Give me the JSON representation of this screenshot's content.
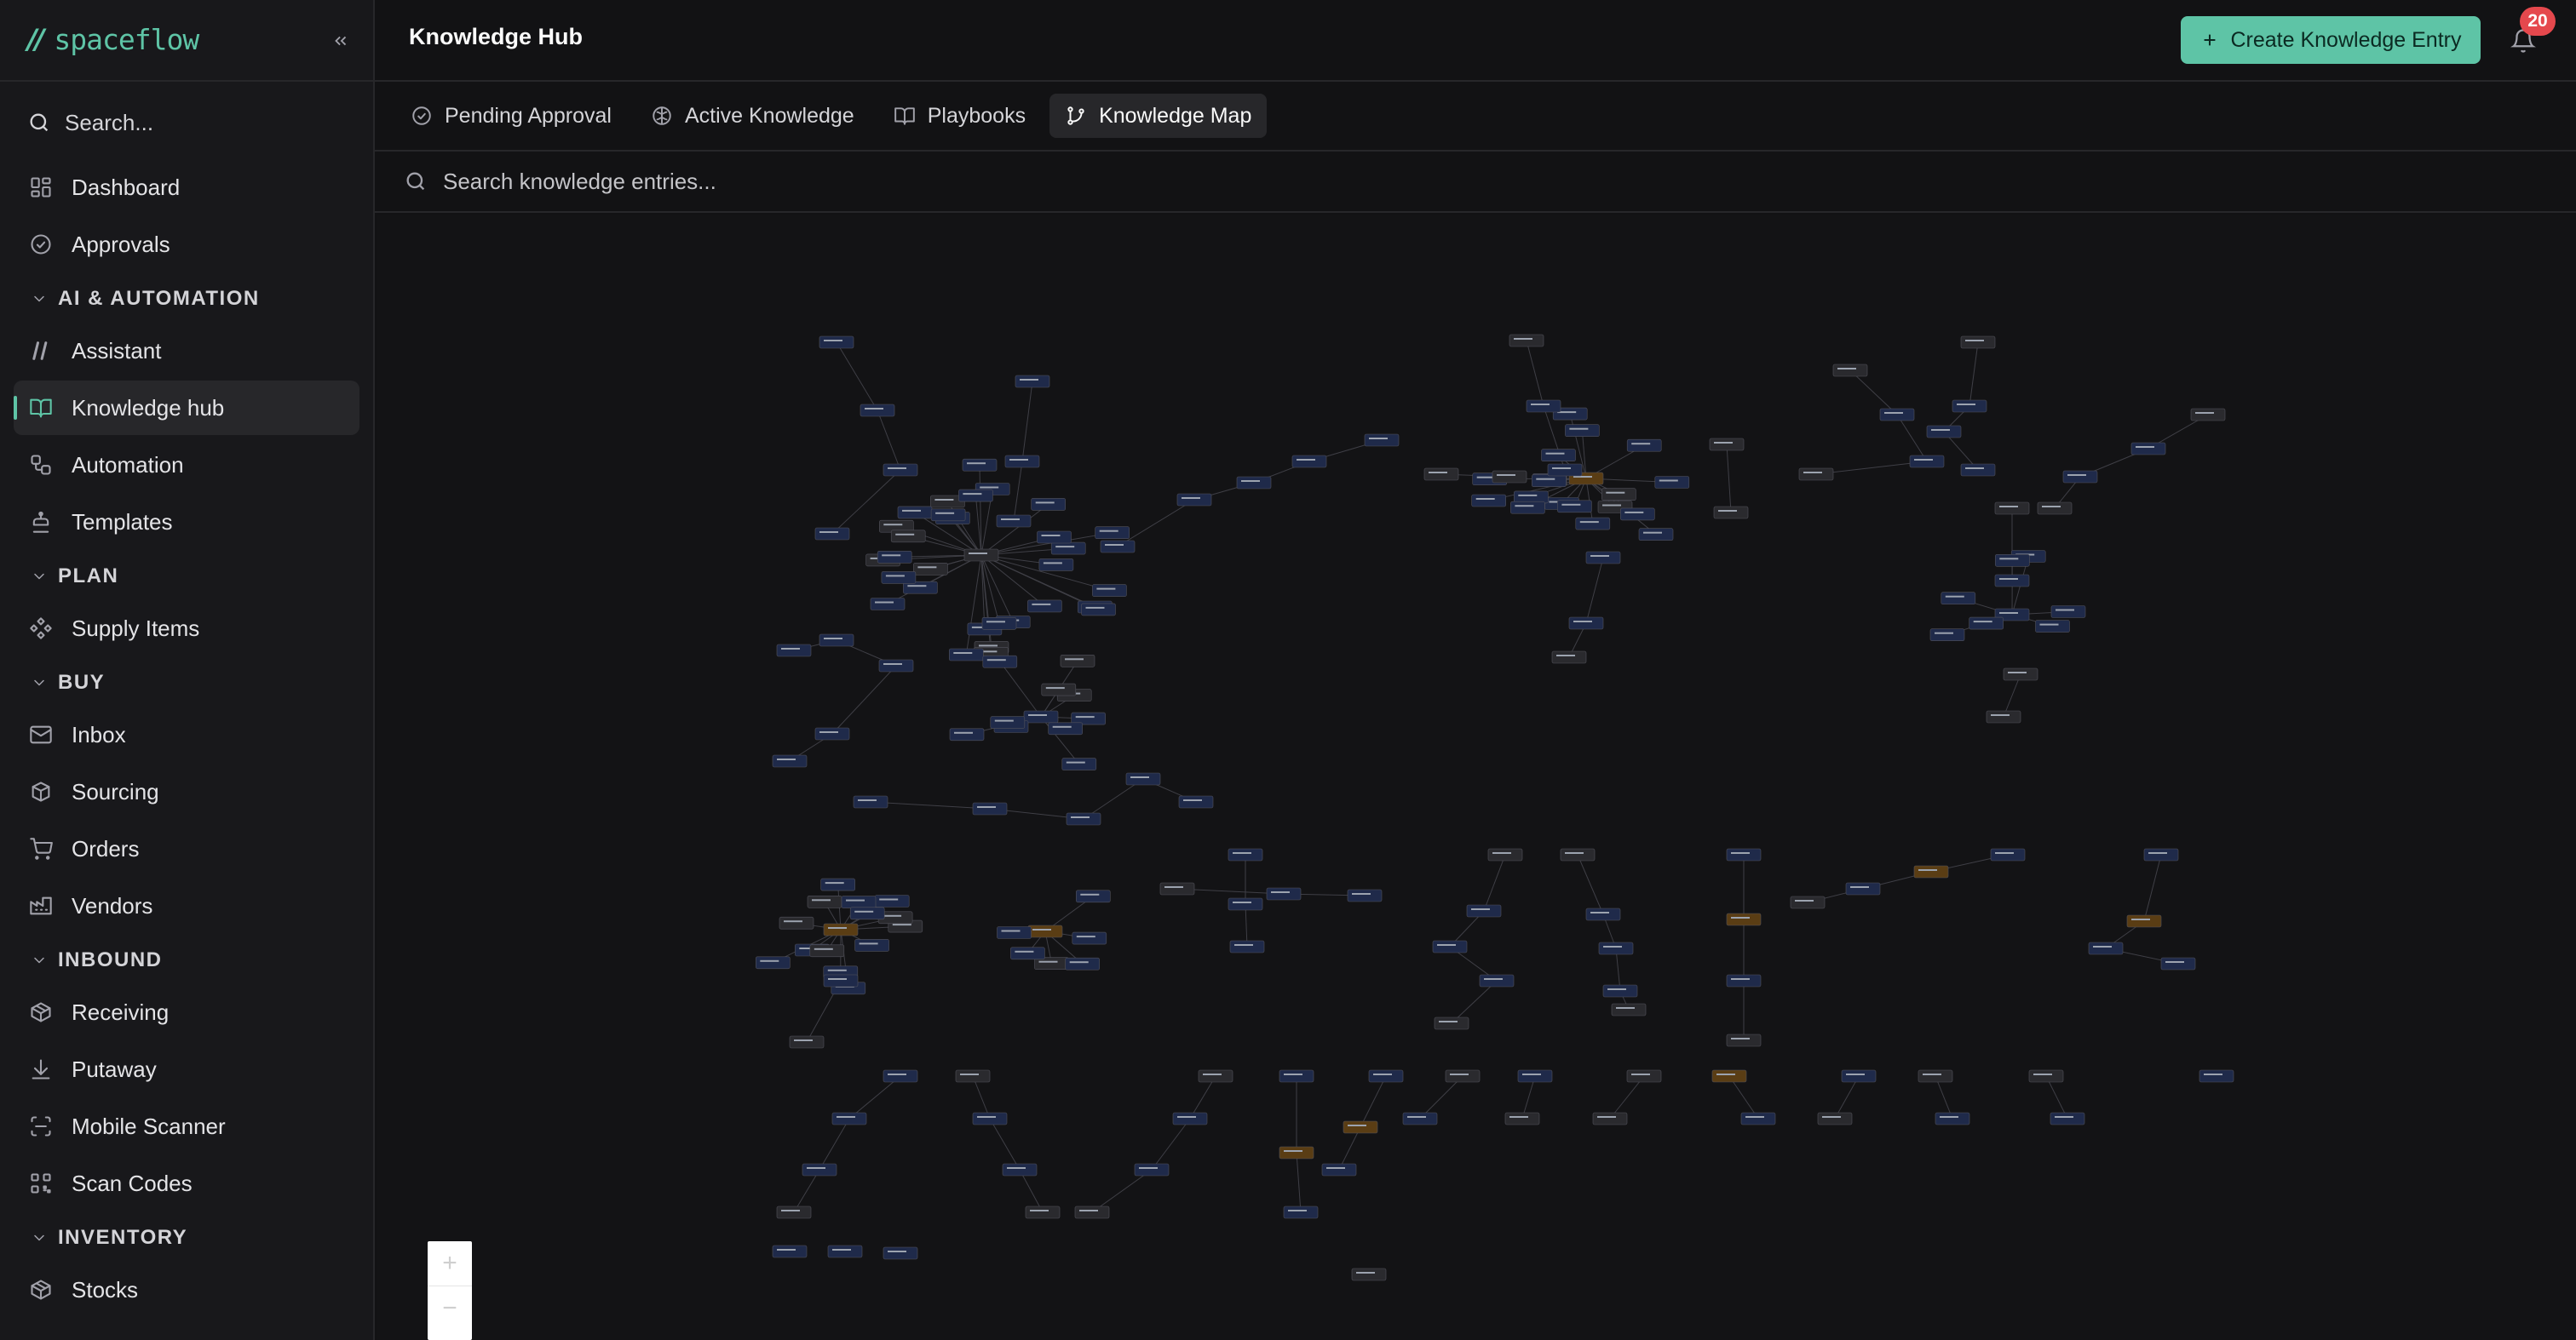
{
  "brand": {
    "mark": "//",
    "name": "spaceflow"
  },
  "sidebar": {
    "search_label": "Search...",
    "items_top": [
      {
        "label": "Dashboard",
        "icon": "dashboard-icon"
      },
      {
        "label": "Approvals",
        "icon": "check-circle-icon"
      }
    ],
    "sections": [
      {
        "title": "AI & AUTOMATION",
        "items": [
          {
            "label": "Assistant",
            "icon": "assistant-icon"
          },
          {
            "label": "Knowledge hub",
            "icon": "book-open-icon",
            "active": true
          },
          {
            "label": "Automation",
            "icon": "workflow-icon"
          },
          {
            "label": "Templates",
            "icon": "stamp-icon"
          }
        ]
      },
      {
        "title": "PLAN",
        "items": [
          {
            "label": "Supply Items",
            "icon": "component-icon"
          }
        ]
      },
      {
        "title": "BUY",
        "items": [
          {
            "label": "Inbox",
            "icon": "mail-icon"
          },
          {
            "label": "Sourcing",
            "icon": "boxes-icon"
          },
          {
            "label": "Orders",
            "icon": "cart-icon"
          },
          {
            "label": "Vendors",
            "icon": "factory-icon"
          }
        ]
      },
      {
        "title": "INBOUND",
        "items": [
          {
            "label": "Receiving",
            "icon": "package-icon"
          },
          {
            "label": "Putaway",
            "icon": "download-icon"
          },
          {
            "label": "Mobile Scanner",
            "icon": "scan-icon"
          },
          {
            "label": "Scan Codes",
            "icon": "qr-code-icon"
          }
        ]
      },
      {
        "title": "INVENTORY",
        "items": [
          {
            "label": "Stocks",
            "icon": "package-icon"
          }
        ]
      }
    ]
  },
  "header": {
    "title": "Knowledge Hub",
    "create_label": "Create Knowledge Entry",
    "notification_count": "20"
  },
  "tabs": [
    {
      "label": "Pending Approval",
      "icon": "check-circle-icon"
    },
    {
      "label": "Active Knowledge",
      "icon": "brain-icon"
    },
    {
      "label": "Playbooks",
      "icon": "book-open-icon"
    },
    {
      "label": "Knowledge Map",
      "icon": "git-branch-icon",
      "active": true
    }
  ],
  "search": {
    "placeholder": "Search knowledge entries..."
  },
  "map": {
    "zoom_in": "+",
    "zoom_out": "−"
  },
  "colors": {
    "accent": "#5ec4a6",
    "node_blue": "#1f2a4a",
    "node_orange": "#5a3d14",
    "node_gray": "#2a2a2e",
    "badge": "#e5484d"
  }
}
